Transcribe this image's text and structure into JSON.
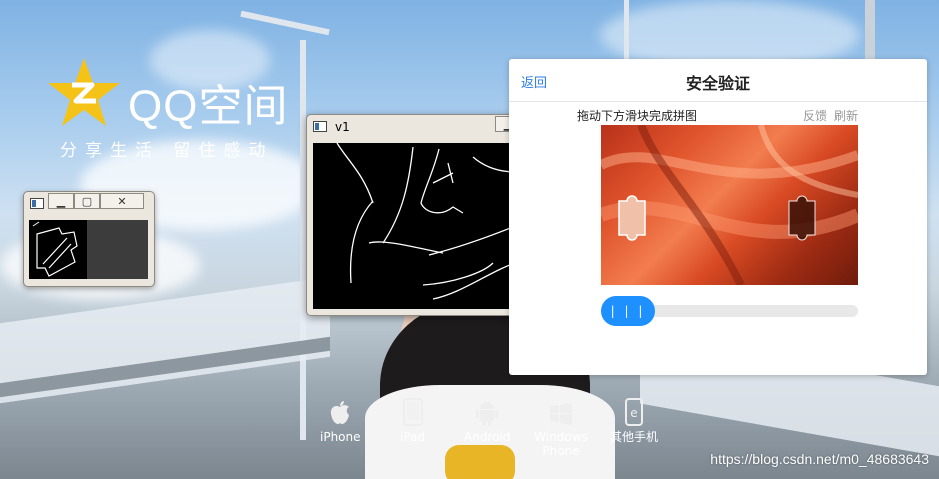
{
  "brand": {
    "name": "QQ空间",
    "slogan": "分享生活  留住感动"
  },
  "windows": {
    "small": {
      "title": ""
    },
    "v1": {
      "title": "v1"
    }
  },
  "dialog": {
    "back_label": "返回",
    "title": "安全验证",
    "instruction": "拖动下方滑块完成拼图",
    "feedback_label": "反馈",
    "refresh_label": "刷新",
    "slider_knob_label": "| | |"
  },
  "downloads": [
    {
      "label": "iPhone",
      "icon": "apple-icon"
    },
    {
      "label": "iPad",
      "icon": "ipad-icon"
    },
    {
      "label": "Android",
      "icon": "android-icon"
    },
    {
      "label": "Windows Phone",
      "icon": "windows-icon"
    },
    {
      "label": "其他手机",
      "icon": "phone-icon"
    }
  ],
  "watermark": "https://blog.csdn.net/m0_48683643",
  "colors": {
    "accent": "#1e90ff",
    "link": "#2c7be5",
    "qq_yellow": "#f5c218"
  }
}
